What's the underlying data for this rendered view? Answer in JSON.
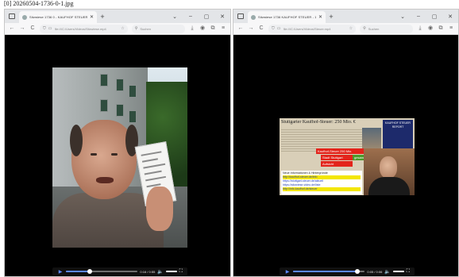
{
  "caption": "[0] 20260504-1736-0-1.jpg",
  "windows": [
    {
      "tab": {
        "title": "Sitzwiese 1736 0 - KAUFHOF STEUER - 9"
      },
      "controls": {
        "minimize": "–",
        "maximize": "▢",
        "close": "✕"
      },
      "nav": {
        "back": "←",
        "forward": "→",
        "reload": "C",
        "url": "file:///C:/Users/Videos/Sitzwiese.mp4",
        "search_placeholder": "Suchen"
      },
      "player": {
        "time": "0:16 / 0:55",
        "progress": 0.33
      }
    },
    {
      "tab": {
        "title": "Sitzwiese 1736 KAUFHOF STEUER - 1"
      },
      "controls": {
        "minimize": "–",
        "maximize": "▢",
        "close": "✕"
      },
      "nav": {
        "back": "←",
        "forward": "→",
        "reload": "C",
        "url": "file:///C:/Users/Videos/Steuer.mp4",
        "search_placeholder": "Suchen"
      },
      "player": {
        "time": "0:05 / 0:06",
        "progress": 0.9
      }
    }
  ],
  "right_video": {
    "headline": "Stuttgarter Kaufhof-Steuer: 250 Mio. €",
    "logo": "KAUFHOF STEUER REPORT",
    "red_1": "Kaufhof-Steuer 250 Mio.",
    "red_2": "Stadt Stuttgart",
    "green": "gesamt",
    "red_3": "Aufsicht",
    "links_head": "Neue Informationen & Hintergründe",
    "links": [
      "http://kaufhof-steuer.de/info",
      "https://stuttgart-steuer.de/aktuell",
      "https://sitzwiese-video.de/liste",
      "http://info.kaufhof.de/steuer"
    ]
  }
}
